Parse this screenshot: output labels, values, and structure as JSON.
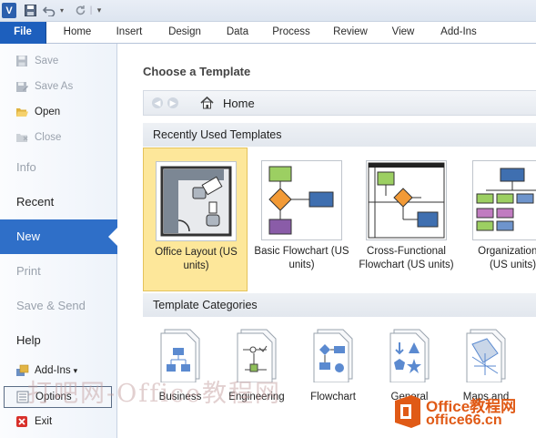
{
  "quick_access": {
    "logo_letter": "V",
    "icons": [
      "save-icon",
      "undo-icon",
      "redo-icon",
      "customize-icon"
    ]
  },
  "ribbon": {
    "file_label": "File",
    "tabs": [
      "Home",
      "Insert",
      "Design",
      "Data",
      "Process",
      "Review",
      "View",
      "Add-Ins"
    ]
  },
  "backstage": {
    "commands_top": [
      {
        "label": "Save",
        "icon": "save-icon",
        "enabled": false
      },
      {
        "label": "Save As",
        "icon": "save-as-icon",
        "enabled": false
      },
      {
        "label": "Open",
        "icon": "open-folder-icon",
        "enabled": true
      },
      {
        "label": "Close",
        "icon": "close-folder-icon",
        "enabled": false
      }
    ],
    "sections": [
      {
        "label": "Info",
        "enabled": false
      },
      {
        "label": "Recent",
        "enabled": true
      },
      {
        "label": "New",
        "enabled": true,
        "selected": true
      },
      {
        "label": "Print",
        "enabled": false
      },
      {
        "label": "Save & Send",
        "enabled": false
      },
      {
        "label": "Help",
        "enabled": true
      }
    ],
    "commands_bottom": [
      {
        "label": "Add-Ins",
        "icon": "add-ins-icon",
        "dropdown": "▾"
      },
      {
        "label": "Options",
        "icon": "options-icon"
      },
      {
        "label": "Exit",
        "icon": "exit-icon"
      }
    ]
  },
  "main": {
    "title": "Choose a Template",
    "nav": {
      "back": "◀",
      "forward": "▶",
      "location": "Home"
    },
    "recent_header": "Recently Used Templates",
    "recent_templates": [
      {
        "line1": "Office Layout (US",
        "line2": "units)",
        "selected": true
      },
      {
        "line1": "Basic Flowchart (US",
        "line2": "units)"
      },
      {
        "line1": "Cross-Functional",
        "line2": "Flowchart (US units)"
      },
      {
        "line1": "Organization C",
        "line2": "(US units)"
      }
    ],
    "categories_header": "Template Categories",
    "categories": [
      "Business",
      "Engineering",
      "Flowchart",
      "General",
      "Maps and"
    ]
  },
  "overlay": {
    "watermark": "打吧网-Office教程网",
    "brand_top": "Office教程网",
    "brand_bottom": "office66.cn"
  },
  "colors": {
    "file_tab": "#1d5fbd",
    "selected_section": "#2f6fc8",
    "selected_template": "#fde79a",
    "brand": "#e05a16"
  }
}
